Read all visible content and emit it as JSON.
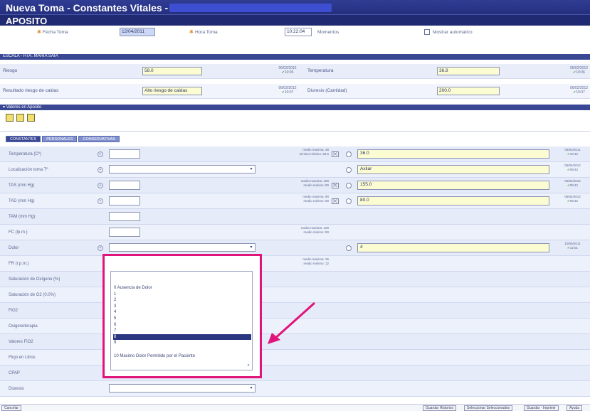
{
  "window": {
    "title": "Nueva Toma - Constantes Vitales -",
    "subtitle": "APOSITO"
  },
  "header_fields": {
    "fecha_label": "Fecha Toma",
    "fecha_value": "12/04/2011",
    "hora_label": "Hora Toma",
    "hora_value": "10:22:04",
    "momentos_label": "Momentos",
    "mostrar_label": "Mostrar automatico"
  },
  "section_bands": {
    "patient": "ESCALA - HTA. MARIA SAIA",
    "valores": "Valores en Aposito"
  },
  "summary_rows": [
    {
      "label": "Riesgo",
      "value": "58.0",
      "meta_date": "06/02/2012",
      "meta_time": "10:06",
      "right_label": "Temperatura",
      "right_value": "36.8",
      "right_date": "06/02/2012",
      "right_time": "10:06"
    },
    {
      "label": "Resultado riesgo de caidas",
      "value": "Alto riesgo de caidas",
      "meta_date": "06/02/2012",
      "meta_time": "10:07",
      "right_label": "Diuresis (Cantidad)",
      "right_value": "200.0",
      "right_date": "06/02/2012",
      "right_time": "10:07"
    }
  ],
  "tabs": [
    "CONSTANTES",
    "PERSONALES",
    "CONSERVATIVAS"
  ],
  "grid_rows": [
    {
      "label": "Temperatura (Cº)",
      "circle": "+",
      "meta": [
        "medio maxima: 38",
        "minimo minimo: 35.5"
      ],
      "button": "[x]",
      "value": "36.0",
      "date": "05/04/2011",
      "time": "10:42"
    },
    {
      "label": "Localización toma Tº",
      "circle": "+",
      "select": true,
      "value": "Axilar",
      "date": "05/04/2012",
      "time": "09:42"
    },
    {
      "label": "TAS (mm Hg)",
      "circle": "+",
      "meta": [
        "medio maxima: 180",
        "medio minimo: 90"
      ],
      "button": "[x]",
      "value": "155.0",
      "date": "05/04/2012",
      "time": "09:42"
    },
    {
      "label": "TAD (mm Hg)",
      "circle": "+",
      "meta": [
        "medio maxima: 90",
        "medio minimo: 60"
      ],
      "button": "[x]",
      "value": "80.0",
      "date": "05/04/2012",
      "time": "09:42"
    },
    {
      "label": "TAM (mm Hg)"
    },
    {
      "label": "FC (lp.m.)",
      "meta": [
        "medio maxima: 100",
        "medio minimo: 50"
      ]
    },
    {
      "label": "Dolor",
      "circle": "+",
      "select": true,
      "value": "4",
      "date": "10/06/2011",
      "time": "12:01"
    },
    {
      "label": "FR (r.p.m.)",
      "meta": [
        "medio maxima: 15",
        "medio minimo: 12"
      ]
    },
    {
      "label": "Saturación de Oxígeno (%)"
    },
    {
      "label": "Saturación de O2 (0.0%)"
    },
    {
      "label": "FiO2"
    },
    {
      "label": "Oxigenoterapia"
    },
    {
      "label": "Valores FiO2"
    },
    {
      "label": "Flujo en Litros"
    },
    {
      "label": "CPAP"
    },
    {
      "label": "Diuresis",
      "select": true
    }
  ],
  "dropdown_items": [
    "0 Ausencia de Dolor",
    "1",
    "2",
    "3",
    "4",
    "5",
    "6",
    "7",
    "8",
    "9",
    "10 Maximo Dolor Permitido por el Paciente"
  ],
  "dropdown_selected_index": 8,
  "footer": {
    "cancel": "Cancelar",
    "guardar_in": "Guardar Historico",
    "seleccionar": "Seleccionar Seleccionados",
    "guardar_imprimir": "Guardar - Imprimir",
    "ayuda": "Ayuda"
  },
  "colors": {
    "title_bar": "#2f3d93",
    "highlight": "#e0147a",
    "field_yellow": "#fcfcd3"
  }
}
